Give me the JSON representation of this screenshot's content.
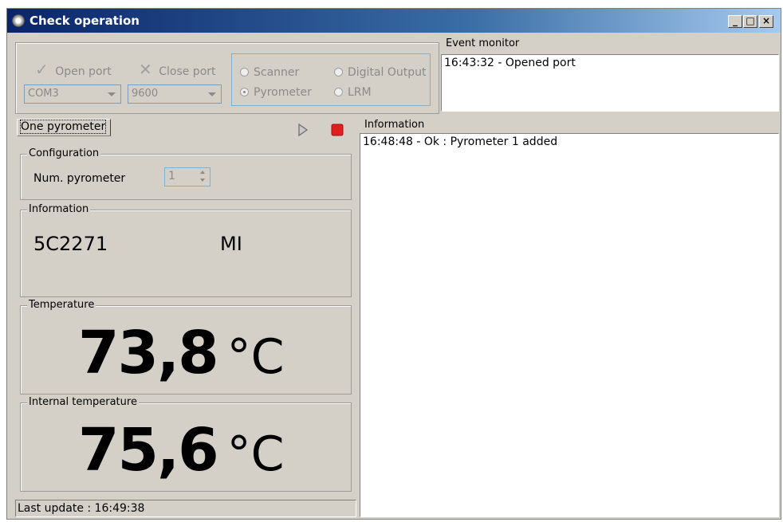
{
  "window": {
    "title": "Check operation",
    "minimize": "_",
    "maximize": "□",
    "close": "×"
  },
  "toolbar": {
    "open_port": "Open port",
    "close_port": "Close port",
    "com_port": "COM3",
    "baud_rate": "9600",
    "radios": {
      "scanner": "Scanner",
      "digital_output": "Digital Output",
      "pyrometer": "Pyrometer",
      "lrm": "LRM",
      "selected": "Pyrometer"
    }
  },
  "event_monitor": {
    "title": "Event monitor",
    "entries": [
      "16:43:32 - Opened port"
    ]
  },
  "tab": {
    "label": "One pyrometer"
  },
  "configuration": {
    "title": "Configuration",
    "num_pyrometer_label": "Num. pyrometer",
    "num_pyrometer_value": "1"
  },
  "device_info": {
    "title": "Information",
    "serial": "5C2271",
    "model": "MI"
  },
  "temperature": {
    "title": "Temperature",
    "value": "73,8",
    "unit": "°C"
  },
  "internal_temperature": {
    "title": "Internal temperature",
    "value": "75,6",
    "unit": "°C"
  },
  "log": {
    "title": "Information",
    "entries": [
      "16:48:48 - Ok : Pyrometer 1 added"
    ]
  },
  "status": {
    "last_update": "Last update : 16:49:38"
  },
  "colors": {
    "title_gradient_start": "#0a246a",
    "stop_button": "#e02020",
    "play_button": "#808080"
  }
}
